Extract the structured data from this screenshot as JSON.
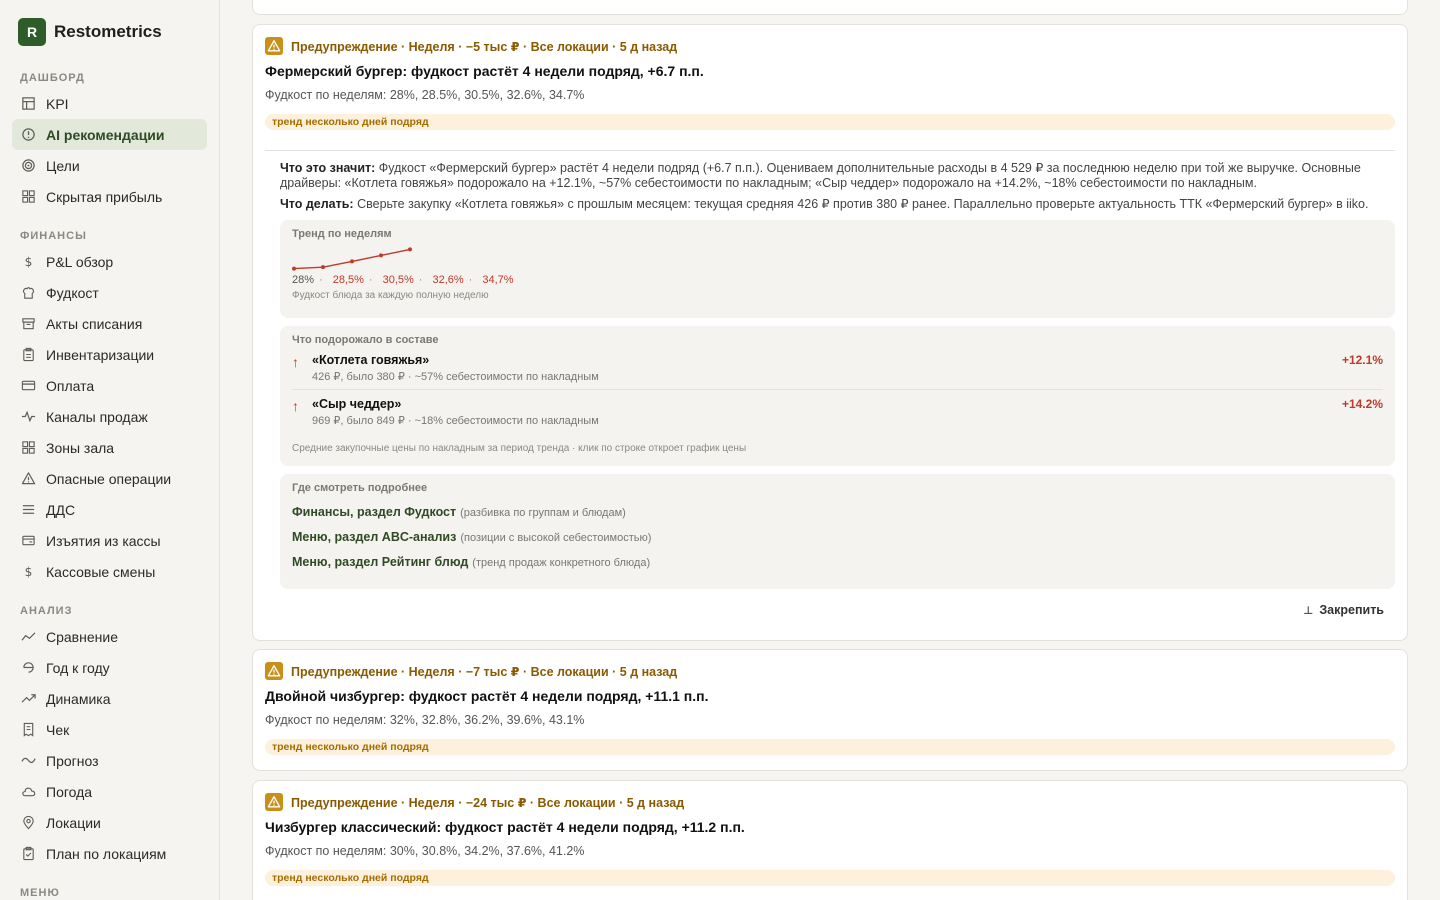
{
  "brand": {
    "logo_letter": "R",
    "name": "Restometrics"
  },
  "sidebar": {
    "sections": [
      {
        "label": "ДАШБОРД",
        "items": [
          {
            "label": "KPI",
            "icon": "table-icon"
          },
          {
            "label": "AI рекомендации",
            "icon": "alert-circle-icon",
            "active": true
          },
          {
            "label": "Цели",
            "icon": "target-icon"
          },
          {
            "label": "Скрытая прибыль",
            "icon": "grid-icon"
          }
        ]
      },
      {
        "label": "ФИНАНСЫ",
        "items": [
          {
            "label": "P&L обзор",
            "icon": "dollar-icon"
          },
          {
            "label": "Фудкост",
            "icon": "chef-hat-icon"
          },
          {
            "label": "Акты списания",
            "icon": "archive-icon"
          },
          {
            "label": "Инвентаризации",
            "icon": "clipboard-icon"
          },
          {
            "label": "Оплата",
            "icon": "credit-card-icon"
          },
          {
            "label": "Каналы продаж",
            "icon": "pulse-icon"
          },
          {
            "label": "Зоны зала",
            "icon": "grid-icon"
          },
          {
            "label": "Опасные операции",
            "icon": "warning-icon"
          },
          {
            "label": "ДДС",
            "icon": "list-icon"
          },
          {
            "label": "Изъятия из кассы",
            "icon": "wallet-icon"
          },
          {
            "label": "Кассовые смены",
            "icon": "dollar-icon"
          }
        ]
      },
      {
        "label": "АНАЛИЗ",
        "items": [
          {
            "label": "Сравнение",
            "icon": "chart-compare-icon"
          },
          {
            "label": "Год к году",
            "icon": "cycle-icon"
          },
          {
            "label": "Динамика",
            "icon": "trending-up-icon"
          },
          {
            "label": "Чек",
            "icon": "receipt-icon"
          },
          {
            "label": "Прогноз",
            "icon": "wave-icon"
          },
          {
            "label": "Погода",
            "icon": "cloud-icon"
          },
          {
            "label": "Локации",
            "icon": "map-pin-icon"
          },
          {
            "label": "План по локациям",
            "icon": "clipboard-check-icon"
          }
        ]
      },
      {
        "label": "МЕНЮ",
        "items": []
      }
    ]
  },
  "cards": [
    {
      "meta": "Предупреждение · Неделя · −5 тыс ₽ · Все локации · 5 д назад",
      "title": "Фермерский бургер: фудкост растёт 4 недели подряд, +6.7 п.п.",
      "subtitle": "Фудкост по неделям: 28%, 28.5%, 30.5%, 32.6%, 34.7%",
      "tag": "тренд несколько дней подряд",
      "expanded": {
        "meaning_label": "Что это значит:",
        "meaning_text": "Фудкост «Фермерский бургер» растёт 4 недели подряд (+6.7 п.п.). Оцениваем дополнительные расходы в 4 529 ₽ за последнюю неделю при той же выручке. Основные драйверы: «Котлета говяжья» подорожало на +12.1%, ~57% себестоимости по накладным; «Сыр чеддер» подорожало на +14.2%, ~18% себестоимости по накладным.",
        "action_label": "Что делать:",
        "action_text": "Сверьте закупку «Котлета говяжья» с прошлым месяцем: текущая средняя 426 ₽ против 380 ₽ ранее. Параллельно проверьте актуальность ТТК «Фермерский бургер» в iiko.",
        "trend_title": "Тренд по неделям",
        "trend_labels": [
          "28%",
          "28,5%",
          "30,5%",
          "32,6%",
          "34,7%"
        ],
        "trend_sep": "·",
        "trend_foot": "Фудкост блюда за каждую полную неделю",
        "ingredients_title": "Что подорожало в составе",
        "ingredients": [
          {
            "name": "«Котлета говяжья»",
            "detail": "426 ₽, было 380 ₽ · ~57% себестоимости по накладным",
            "delta": "+12.1%"
          },
          {
            "name": "«Сыр чеддер»",
            "detail": "969 ₽, было 849 ₽ · ~18% себестоимости по накладным",
            "delta": "+14.2%"
          }
        ],
        "ingredients_foot": "Средние закупочные цены по накладным за период тренда · клик по строке откроет график цены",
        "links_title": "Где смотреть подробнее",
        "links": [
          {
            "label": "Финансы, раздел Фудкост",
            "hint": "(разбивка по группам и блюдам)"
          },
          {
            "label": "Меню, раздел ABC-анализ",
            "hint": "(позиции с высокой себестоимостью)"
          },
          {
            "label": "Меню, раздел Рейтинг блюд",
            "hint": "(тренд продаж конкретного блюда)"
          }
        ],
        "pin_label": "Закрепить"
      }
    },
    {
      "meta": "Предупреждение · Неделя · −7 тыс ₽ · Все локации · 5 д назад",
      "title": "Двойной чизбургер: фудкост растёт 4 недели подряд, +11.1 п.п.",
      "subtitle": "Фудкост по неделям: 32%, 32.8%, 36.2%, 39.6%, 43.1%",
      "tag": "тренд несколько дней подряд"
    },
    {
      "meta": "Предупреждение · Неделя · −24 тыс ₽ · Все локации · 5 д назад",
      "title": "Чизбургер классический: фудкост растёт 4 недели подряд, +11.2 п.п.",
      "subtitle": "Фудкост по неделям: 30%, 30.8%, 34.2%, 37.6%, 41.2%",
      "tag": "тренд несколько дней подряд"
    }
  ],
  "chart_data": {
    "type": "line",
    "title": "Тренд по неделям",
    "x": [
      1,
      2,
      3,
      4,
      5
    ],
    "values": [
      28,
      28.5,
      30.5,
      32.6,
      34.7
    ],
    "color": "#c0392b"
  },
  "colors": {
    "accent": "#2f5d2a",
    "warning": "#c8901a",
    "danger": "#c0392b"
  }
}
